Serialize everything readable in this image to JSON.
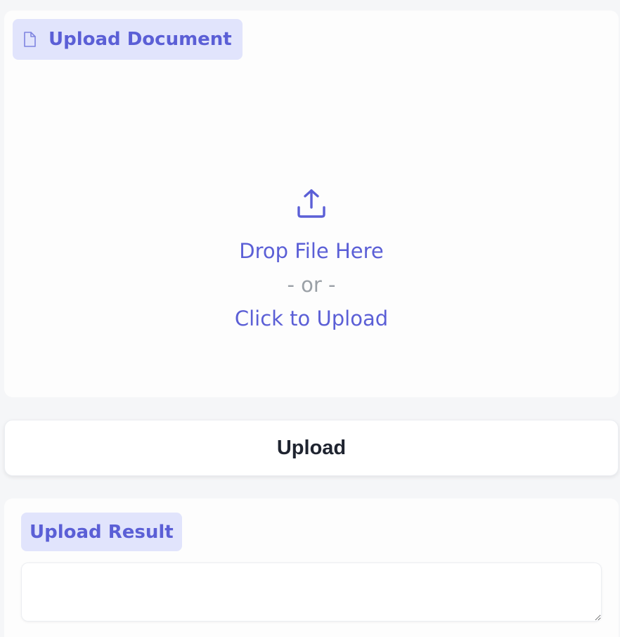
{
  "upload_panel": {
    "label": "Upload Document",
    "label_icon": "file-icon",
    "drop_icon": "upload-icon",
    "drop_text": "Drop File Here",
    "or_text": "- or -",
    "click_text": "Click to Upload"
  },
  "upload_button": {
    "label": "Upload"
  },
  "result_panel": {
    "label": "Upload Result",
    "value": ""
  },
  "colors": {
    "accent": "#5b5fd6",
    "label_background": "#e1e4fc",
    "muted_text": "#9aa0a6",
    "page_background": "#f5f6f8"
  }
}
